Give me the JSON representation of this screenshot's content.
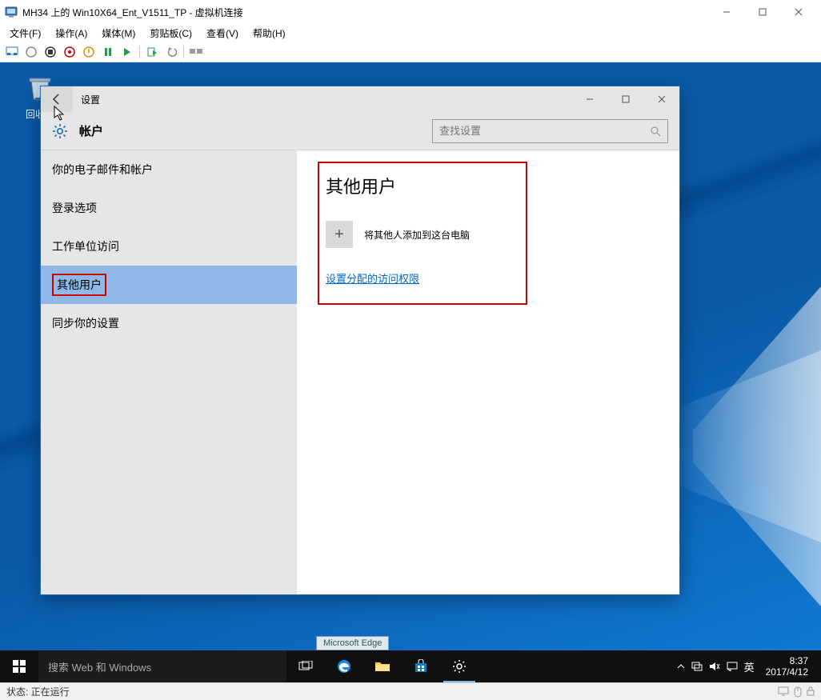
{
  "vm": {
    "title": "MH34 上的 Win10X64_Ent_V1511_TP - 虚拟机连接",
    "menu": [
      "文件(F)",
      "操作(A)",
      "媒体(M)",
      "剪贴板(C)",
      "查看(V)",
      "帮助(H)"
    ],
    "status": "状态: 正在运行"
  },
  "desktop": {
    "recycle_label": "回收站"
  },
  "settings": {
    "window_title": "设置",
    "crumb": "帐户",
    "search_placeholder": "查找设置",
    "side_items": [
      "你的电子邮件和帐户",
      "登录选项",
      "工作单位访问",
      "其他用户",
      "同步你的设置"
    ],
    "active_index": 3,
    "content": {
      "heading": "其他用户",
      "add_label": "将其他人添加到这台电脑",
      "assign_link": "设置分配的访问权限"
    }
  },
  "taskbar": {
    "search_placeholder": "搜索 Web 和 Windows",
    "edge_tooltip": "Microsoft Edge",
    "ime": "英",
    "time": "8:37",
    "date": "2017/4/12"
  }
}
